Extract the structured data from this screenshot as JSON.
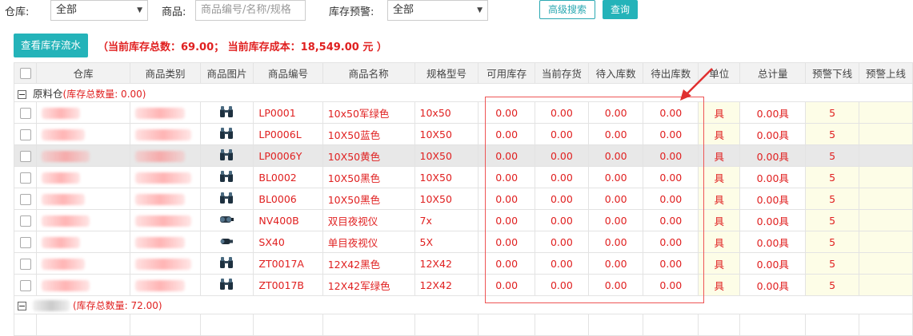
{
  "filters": {
    "warehouse_label": "仓库:",
    "warehouse_value": "全部",
    "goods_label": "商品:",
    "goods_placeholder": "商品编号/名称/规格",
    "alert_label": "库存预警:",
    "alert_value": "全部",
    "advanced_search": "高级搜索",
    "query": "查询"
  },
  "toolbar": {
    "view_flow": "查看库存流水",
    "summary": "（当前库存总数：69.00； 当前库存成本：18,549.00 元 ）"
  },
  "columns": [
    "仓库",
    "商品类别",
    "商品图片",
    "商品编号",
    "商品名称",
    "规格型号",
    "可用库存",
    "当前存货",
    "待入库数",
    "待出库数",
    "单位",
    "总计量",
    "预警下线",
    "预警上线"
  ],
  "groups": [
    {
      "name": "原料仓",
      "summary": "(库存总数量: 0.00)"
    },
    {
      "name": "",
      "summary": "(库存总数量: 72.00)"
    }
  ],
  "rows": [
    {
      "code": "LP0001",
      "name": "10x50军绿色",
      "spec": "10x50",
      "available": "0.00",
      "current": "0.00",
      "pending_in": "0.00",
      "pending_out": "0.00",
      "unit": "具",
      "total": "0.00具",
      "alert_low": "5",
      "alert_high": "",
      "icon": "binocular-icon",
      "highlighted": false
    },
    {
      "code": "LP0006L",
      "name": "10X50蓝色",
      "spec": "10X50",
      "available": "0.00",
      "current": "0.00",
      "pending_in": "0.00",
      "pending_out": "0.00",
      "unit": "具",
      "total": "0.00具",
      "alert_low": "5",
      "alert_high": "",
      "icon": "binocular-icon",
      "highlighted": false
    },
    {
      "code": "LP0006Y",
      "name": "10X50黄色",
      "spec": "10X50",
      "available": "0.00",
      "current": "0.00",
      "pending_in": "0.00",
      "pending_out": "0.00",
      "unit": "具",
      "total": "0.00具",
      "alert_low": "5",
      "alert_high": "",
      "icon": "binocular-icon",
      "highlighted": true
    },
    {
      "code": "BL0002",
      "name": "10X50黑色",
      "spec": "10X50",
      "available": "0.00",
      "current": "0.00",
      "pending_in": "0.00",
      "pending_out": "0.00",
      "unit": "具",
      "total": "0.00具",
      "alert_low": "5",
      "alert_high": "",
      "icon": "binocular-icon",
      "highlighted": false
    },
    {
      "code": "BL0006",
      "name": "10X50黑色",
      "spec": "10X50",
      "available": "0.00",
      "current": "0.00",
      "pending_in": "0.00",
      "pending_out": "0.00",
      "unit": "具",
      "total": "0.00具",
      "alert_low": "5",
      "alert_high": "",
      "icon": "binocular-icon",
      "highlighted": false
    },
    {
      "code": "NV400B",
      "name": "双目夜视仪",
      "spec": "7x",
      "available": "0.00",
      "current": "0.00",
      "pending_in": "0.00",
      "pending_out": "0.00",
      "unit": "具",
      "total": "0.00具",
      "alert_low": "5",
      "alert_high": "",
      "icon": "night-vision-icon",
      "highlighted": false
    },
    {
      "code": "SX40",
      "name": "单目夜视仪",
      "spec": "5X",
      "available": "0.00",
      "current": "0.00",
      "pending_in": "0.00",
      "pending_out": "0.00",
      "unit": "具",
      "total": "0.00具",
      "alert_low": "5",
      "alert_high": "",
      "icon": "monocular-icon",
      "highlighted": false
    },
    {
      "code": "ZT0017A",
      "name": "12X42黑色",
      "spec": "12X42",
      "available": "0.00",
      "current": "0.00",
      "pending_in": "0.00",
      "pending_out": "0.00",
      "unit": "具",
      "total": "0.00具",
      "alert_low": "5",
      "alert_high": "",
      "icon": "binocular-icon",
      "highlighted": false
    },
    {
      "code": "ZT0017B",
      "name": "12X42军绿色",
      "spec": "12X42",
      "available": "0.00",
      "current": "0.00",
      "pending_in": "0.00",
      "pending_out": "0.00",
      "unit": "具",
      "total": "0.00具",
      "alert_low": "5",
      "alert_high": "",
      "icon": "binocular-icon",
      "highlighted": false
    }
  ],
  "colors": {
    "accent": "#24b3b9",
    "value_red": "#e02020",
    "alert_yellow": "#fdfde7",
    "annotation_red": "#e55555"
  }
}
